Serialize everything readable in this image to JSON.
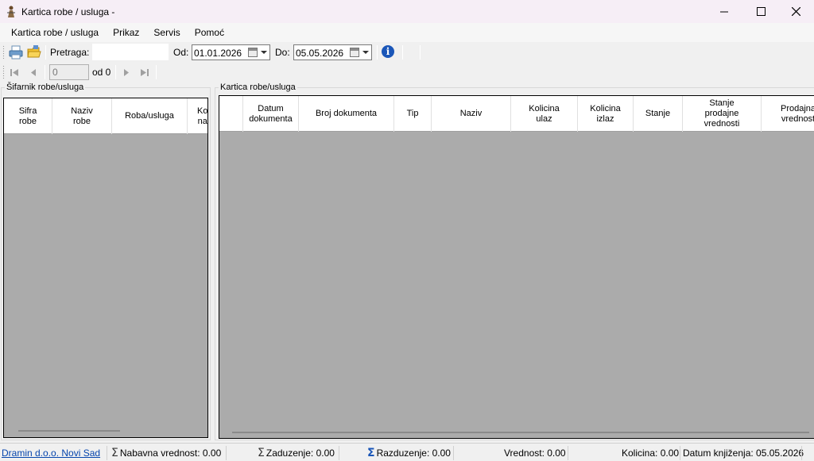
{
  "window": {
    "title": "Kartica robe / usluga -"
  },
  "menu": [
    "Kartica robe / usluga",
    "Prikaz",
    "Servis",
    "Pomoć"
  ],
  "toolbar": {
    "search_label": "Pretraga:",
    "search_value": "",
    "od_label": "Od:",
    "od_value": "01.01.2026",
    "do_label": "Do:",
    "do_value": "05.05.2026"
  },
  "navigator": {
    "position": "0",
    "of_label": "od 0"
  },
  "left_panel": {
    "title": "Šifarnik robe/usluga",
    "columns": [
      "Sifra\nrobe",
      "Naziv\nrobe",
      "Roba/usluga",
      "Ko\nna"
    ]
  },
  "right_panel": {
    "title": "Kartica robe/usluga",
    "columns": [
      "",
      "Datum\ndokumenta",
      "Broj dokumenta",
      "Tip",
      "Naziv",
      "Kolicina\nulaz",
      "Kolicina\nizlaz",
      "Stanje",
      "Stanje\nprodajne\nvrednosti",
      "Prodajna\nvrednost"
    ]
  },
  "status": {
    "company": "Dramin d.o.o. Novi Sad",
    "nabavna": "Nabavna vrednost: 0.00",
    "zaduzenje": "Zaduzenje: 0.00",
    "razduzenje": "Razduzenje: 0.00",
    "vrednost": "Vrednost: 0.00",
    "kolicina": "Kolicina: 0.00",
    "datum": "Datum knjiženja: 05.05.2026"
  },
  "icons": {
    "app": "bookkeeper-icon",
    "print": "print-icon",
    "open": "open-folder-icon",
    "info": "info-icon",
    "sigma": "sigma-icon"
  },
  "colors": {
    "grid_bg": "#ababab",
    "link": "#0645ad",
    "info": "#1a56b8"
  }
}
